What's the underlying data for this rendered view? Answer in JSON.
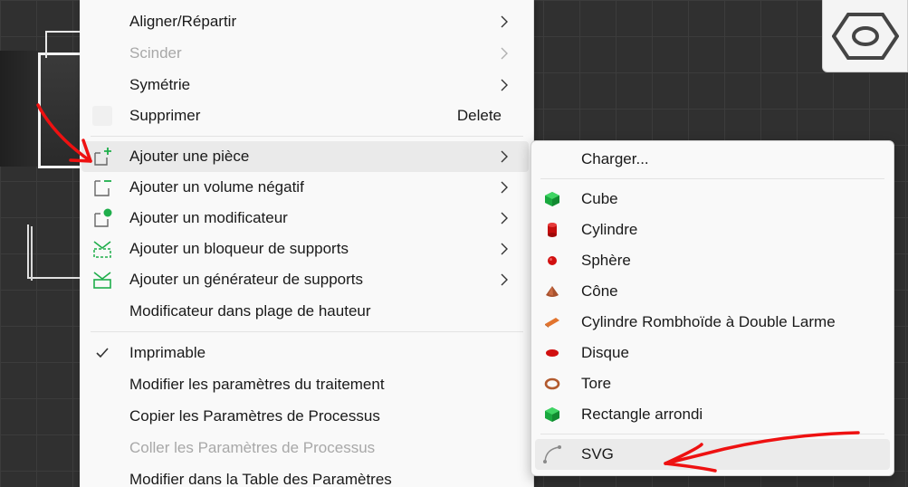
{
  "main_menu": {
    "items": [
      {
        "label": "Aligner/Répartir",
        "shortcut": "",
        "has_submenu": true,
        "disabled": false,
        "icon": ""
      },
      {
        "label": "Scinder",
        "shortcut": "",
        "has_submenu": true,
        "disabled": true,
        "icon": ""
      },
      {
        "label": "Symétrie",
        "shortcut": "",
        "has_submenu": true,
        "disabled": false,
        "icon": ""
      },
      {
        "label": "Supprimer",
        "shortcut": "Delete",
        "has_submenu": false,
        "disabled": false,
        "icon": ""
      },
      {
        "label": "Ajouter une pièce",
        "shortcut": "",
        "has_submenu": true,
        "disabled": false,
        "icon": "add-part-icon"
      },
      {
        "label": "Ajouter un volume négatif",
        "shortcut": "",
        "has_submenu": true,
        "disabled": false,
        "icon": "add-negative-volume-icon"
      },
      {
        "label": "Ajouter un modificateur",
        "shortcut": "",
        "has_submenu": true,
        "disabled": false,
        "icon": "add-modifier-icon"
      },
      {
        "label": "Ajouter un bloqueur de supports",
        "shortcut": "",
        "has_submenu": true,
        "disabled": false,
        "icon": "support-blocker-icon"
      },
      {
        "label": "Ajouter un générateur de supports",
        "shortcut": "",
        "has_submenu": true,
        "disabled": false,
        "icon": "support-enforcer-icon"
      },
      {
        "label": "Modificateur dans plage de hauteur",
        "shortcut": "",
        "has_submenu": false,
        "disabled": false,
        "icon": ""
      },
      {
        "label": "Imprimable",
        "shortcut": "",
        "has_submenu": false,
        "disabled": false,
        "checked": true,
        "icon": "checkmark-icon"
      },
      {
        "label": "Modifier les paramètres du traitement",
        "shortcut": "",
        "has_submenu": false,
        "disabled": false,
        "icon": ""
      },
      {
        "label": "Copier les Paramètres de Processus",
        "shortcut": "",
        "has_submenu": false,
        "disabled": false,
        "icon": ""
      },
      {
        "label": "Coller les Paramètres de Processus",
        "shortcut": "",
        "has_submenu": false,
        "disabled": true,
        "icon": ""
      },
      {
        "label": "Modifier dans la Table des Paramètres",
        "shortcut": "",
        "has_submenu": false,
        "disabled": false,
        "icon": ""
      }
    ]
  },
  "submenu": {
    "items": [
      {
        "label": "Charger...",
        "icon": ""
      },
      {
        "label": "Cube",
        "icon": "green-cube-icon"
      },
      {
        "label": "Cylindre",
        "icon": "red-cylinder-icon"
      },
      {
        "label": "Sphère",
        "icon": "red-sphere-icon"
      },
      {
        "label": "Cône",
        "icon": "brown-cone-icon"
      },
      {
        "label": "Cylindre Rombhoïde à Double Larme",
        "icon": "orange-bar-icon"
      },
      {
        "label": "Disque",
        "icon": "red-disc-icon"
      },
      {
        "label": "Tore",
        "icon": "torus-icon"
      },
      {
        "label": "Rectangle arrondi",
        "icon": "green-rounded-rect-icon"
      },
      {
        "label": "SVG",
        "icon": "svg-curve-icon"
      }
    ]
  },
  "colors": {
    "menu_bg": "#f9f9f9",
    "hover_bg": "#eaeaea",
    "disabled_text": "#a8a8a8",
    "green_accent": "#1fae4b",
    "red_shape": "#d10f0f",
    "annotation_red": "#e11"
  }
}
